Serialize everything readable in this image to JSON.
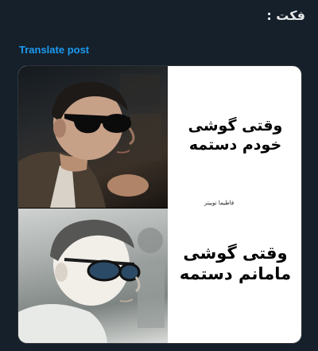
{
  "post": {
    "text": "فکت :",
    "translate_label": "Translate post"
  },
  "meme": {
    "caption_top": "وقتی گوشی خودم دستمه",
    "caption_bottom": "وقتی گوشی مامانم دستمه",
    "watermark": "فاطیما توییتر"
  }
}
